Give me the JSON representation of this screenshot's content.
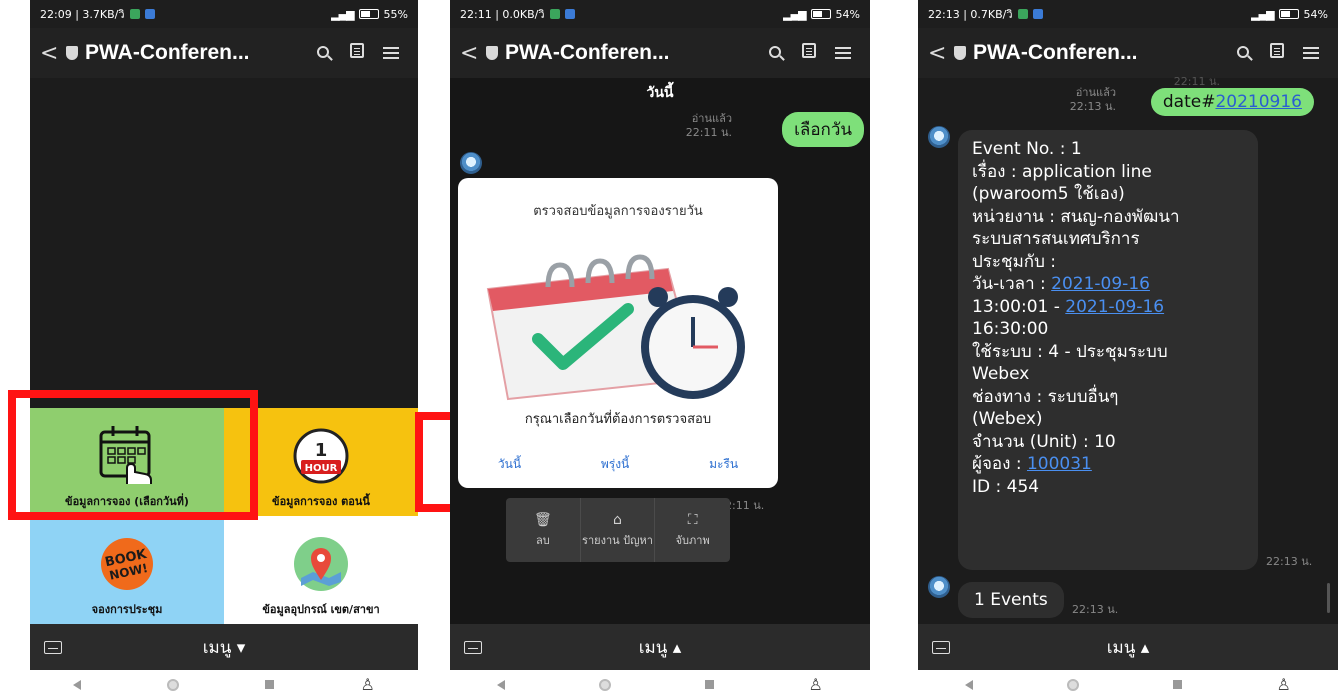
{
  "common": {
    "app_title": "PWA-Conferen...",
    "menu_label": "เมนู ▾",
    "menu_label_2": "เมนู ▴"
  },
  "phone1": {
    "status_left": "22:09 | 3.7KB/วิ",
    "battery": "55",
    "richmenu": [
      {
        "label": "ข้อมูลการจอง (เลือกวันที่)",
        "bg": "#8fce6e"
      },
      {
        "label": "ข้อมูลการจอง ตอนนี้",
        "bg": "#f6c20f",
        "icon_text": "HOUR",
        "icon_num": "1"
      },
      {
        "label": "จองการประชุม",
        "bg": "#8fd3f5",
        "icon_text": "BOOK NOW!"
      },
      {
        "label": "ข้อมูลอุปกรณ์ เขต/สาขา",
        "bg": "#ffffff"
      }
    ]
  },
  "phone2": {
    "status_left": "22:11 | 0.0KB/วิ",
    "battery": "54",
    "date_divider": "วันนี้",
    "read_label": "อ่านแล้ว",
    "read_time": "22:11 น.",
    "user_message": "เลือกวัน",
    "card_title": "ตรวจสอบข้อมูลการจองรายวัน",
    "card_prompt": "กรุณาเลือกวันที่ต้องการตรวจสอบ",
    "choices": [
      "วันนี้",
      "พรุ่งนี้",
      "มะรืน"
    ],
    "card_time": "22:11 น.",
    "context_menu": [
      {
        "icon": "trash-icon",
        "label": "ลบ"
      },
      {
        "icon": "report-icon",
        "label": "รายงาน ปัญหา"
      },
      {
        "icon": "capture-icon",
        "label": "จับภาพ"
      }
    ]
  },
  "phone3": {
    "status_left": "22:13 | 0.7KB/วิ",
    "battery": "54",
    "top_cut_time": "22:11 น.",
    "read_label": "อ่านแล้ว",
    "read_time": "22:13 น.",
    "user_message_prefix": "date#",
    "user_message_link": "20210916",
    "event": {
      "line1": "Event No. : 1",
      "line2": "เรื่อง : application line",
      "line3": "(pwaroom5 ใช้เอง)",
      "line4": "หน่วยงาน : สนญ-กองพัฒนา",
      "line5": "ระบบสารสนเทศบริการ",
      "line6": "ประชุมกับ :",
      "line7_prefix": "วัน-เวลา : ",
      "line7_link": "2021-09-16",
      "line8_prefix": "13:00:01 - ",
      "line8_link": "2021-09-16",
      "line9": "16:30:00",
      "line10": "ใช้ระบบ : 4 - ประชุมระบบ",
      "line11": "Webex",
      "line12": "ช่องทาง : ระบบอื่นๆ",
      "line13": "(Webex)",
      "line14": "จำนวน (Unit) : 10",
      "line15_prefix": "ผู้จอง : ",
      "line15_link": "100031",
      "line16": "ID : 454"
    },
    "event_time": "22:13 น.",
    "events_count": "1 Events",
    "events_time": "22:13 น."
  }
}
